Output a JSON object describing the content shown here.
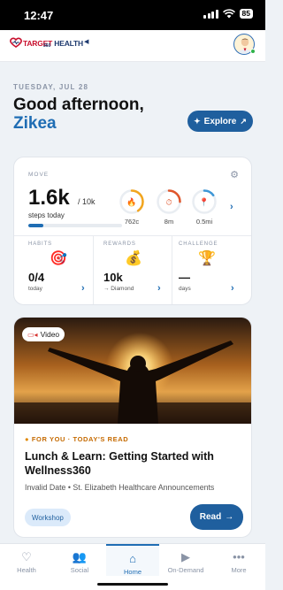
{
  "status_bar": {
    "time": "12:47",
    "battery": "85"
  },
  "brand": {
    "name_part1": "TARGET",
    "name_part2": "HEALTH",
    "sub": "360"
  },
  "greeting": {
    "date": "TUESDAY, JUL 28",
    "line1": "Good afternoon,",
    "name": "Zikea",
    "explore_label": "Explore"
  },
  "move": {
    "label": "MOVE",
    "steps": "1.6k",
    "goal": "/ 10k",
    "steps_caption": "steps today",
    "progress_fraction": 0.16,
    "rings": [
      {
        "icon": "flame-icon",
        "label": "762c",
        "fraction": 0.4,
        "color": "#f2a51e",
        "glyph": "🔥"
      },
      {
        "icon": "stopwatch-icon",
        "label": "8m",
        "fraction": 0.25,
        "color": "#e0562b",
        "glyph": "⏱"
      },
      {
        "icon": "location-pin-icon",
        "label": "0.5mi",
        "fraction": 0.15,
        "color": "#3d96d6",
        "glyph": "📍"
      }
    ]
  },
  "mini_stats": [
    {
      "label": "HABITS",
      "icon": "target-icon",
      "glyph": "🎯",
      "value": "0/4",
      "sub": "today"
    },
    {
      "label": "REWARDS",
      "icon": "money-bag-icon",
      "glyph": "💰",
      "value": "10k",
      "sub": "→ Diamond"
    },
    {
      "label": "CHALLENGE",
      "icon": "trophy-icon",
      "glyph": "🏆",
      "value": "—",
      "sub": "days"
    }
  ],
  "article": {
    "badge": "Video",
    "kicker": "FOR YOU · TODAY'S READ",
    "title": "Lunch & Learn: Getting Started with Wellness360",
    "meta": "Invalid Date • St. Elizabeth Healthcare Announcements",
    "tag": "Workshop",
    "read_label": "Read"
  },
  "tabs": [
    {
      "label": "Health",
      "icon": "heart-icon",
      "glyph": "♡",
      "active": false
    },
    {
      "label": "Social",
      "icon": "people-icon",
      "glyph": "👥",
      "active": false
    },
    {
      "label": "Home",
      "icon": "home-icon",
      "glyph": "⌂",
      "active": true
    },
    {
      "label": "On-Demand",
      "icon": "play-screen-icon",
      "glyph": "▶",
      "active": false
    },
    {
      "label": "More",
      "icon": "more-dots-icon",
      "glyph": "•••",
      "active": false
    }
  ]
}
